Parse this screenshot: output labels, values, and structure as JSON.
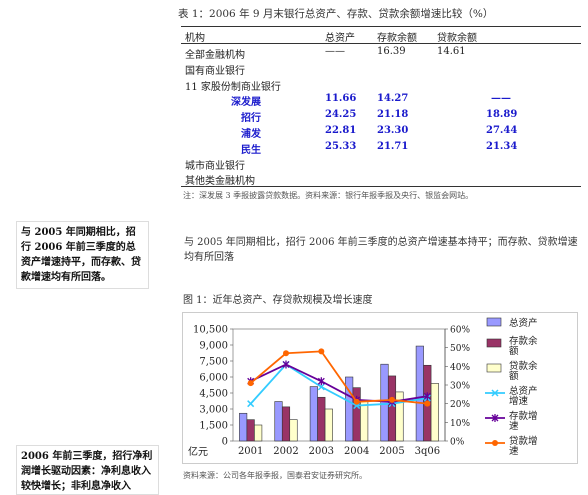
{
  "table": {
    "caption": "表 1：2006 年 9 月末银行总资产、存款、贷款余额增速比较（%）",
    "headers": [
      "机构",
      "总资产",
      "存款余额",
      "贷款余额"
    ],
    "rows": [
      {
        "name": "全部金融机构",
        "v1": "——",
        "v2": "16.39",
        "v3": "14.61",
        "style": "normal"
      },
      {
        "name": "国有商业银行",
        "v1": "",
        "v2": "",
        "v3": "",
        "style": "normal"
      },
      {
        "name": "11 家股份制商业银行",
        "v1": "",
        "v2": "",
        "v3": "",
        "style": "normal"
      },
      {
        "name": "深发展",
        "v1": "11.66",
        "v2": "14.27",
        "v3": "——",
        "style": "blue",
        "indent": 50
      },
      {
        "name": "招行",
        "v1": "24.25",
        "v2": "21.18",
        "v3": "18.89",
        "style": "blue",
        "indent": 60
      },
      {
        "name": "浦发",
        "v1": "22.81",
        "v2": "23.30",
        "v3": "27.44",
        "style": "blue",
        "indent": 60
      },
      {
        "name": "民生",
        "v1": "25.33",
        "v2": "21.71",
        "v3": "21.34",
        "style": "blue",
        "indent": 60
      },
      {
        "name": "城市商业银行",
        "v1": "",
        "v2": "",
        "v3": "",
        "style": "normal"
      },
      {
        "name": "其他类金融机构",
        "v1": "",
        "v2": "",
        "v3": "",
        "style": "normal"
      }
    ],
    "note": "注：深发展 3 季报披露贷款数据。资料来源：银行年报季报及央行、银监会网站。"
  },
  "side_note_1": "与 2005 年同期相比，招行 2006 年前三季度的总资产增速持平，而存款、贷款增速均有所回落。",
  "main_paragraph": "与 2005 年同期相比，招行 2006 年前三季度的总资产增速基本持平；而存款、贷款增速均有所回落",
  "chart_caption": "图 1：近年总资产、存贷款规模及增长速度",
  "chart_source": "资料来源：公司各年报季报，国泰君安证券研究所。",
  "side_note_2": "2006 年前三季度，招行净利润增长驱动因素：净利息收入较快增长；非利息净收入",
  "chart_data": {
    "type": "bar+line",
    "categories": [
      "2001",
      "2002",
      "2003",
      "2004",
      "2005",
      "3q06"
    ],
    "unit_label": "亿元",
    "ylim_left": [
      0,
      10500
    ],
    "yticks_left": [
      "0",
      "1,500",
      "3,000",
      "4,500",
      "6,000",
      "7,500",
      "9,000",
      "10,500"
    ],
    "ylim_right": [
      0,
      60
    ],
    "yticks_right": [
      "0%",
      "10%",
      "20%",
      "30%",
      "40%",
      "50%",
      "60%"
    ],
    "bar_series": [
      {
        "name": "总资产",
        "color": "#9999ff",
        "values": [
          2600,
          3700,
          5100,
          6000,
          7200,
          8900
        ]
      },
      {
        "name": "存款余额",
        "color": "#993366",
        "values": [
          2000,
          3200,
          4100,
          5000,
          6100,
          7100
        ]
      },
      {
        "name": "贷款余额",
        "color": "#ffffcc",
        "values": [
          1500,
          2000,
          3000,
          3700,
          4600,
          5400
        ]
      }
    ],
    "line_series": [
      {
        "name": "总资产增速",
        "color": "#33ccff",
        "marker": "x",
        "values": [
          20,
          41,
          29,
          19,
          20,
          23
        ]
      },
      {
        "name": "存款增速",
        "color": "#660099",
        "marker": "star",
        "values": [
          32,
          41,
          32,
          22,
          21,
          24
        ]
      },
      {
        "name": "贷款增速",
        "color": "#ff6600",
        "marker": "circle",
        "values": [
          31,
          47,
          48,
          21,
          22,
          20
        ]
      }
    ],
    "legend_position": "right"
  }
}
